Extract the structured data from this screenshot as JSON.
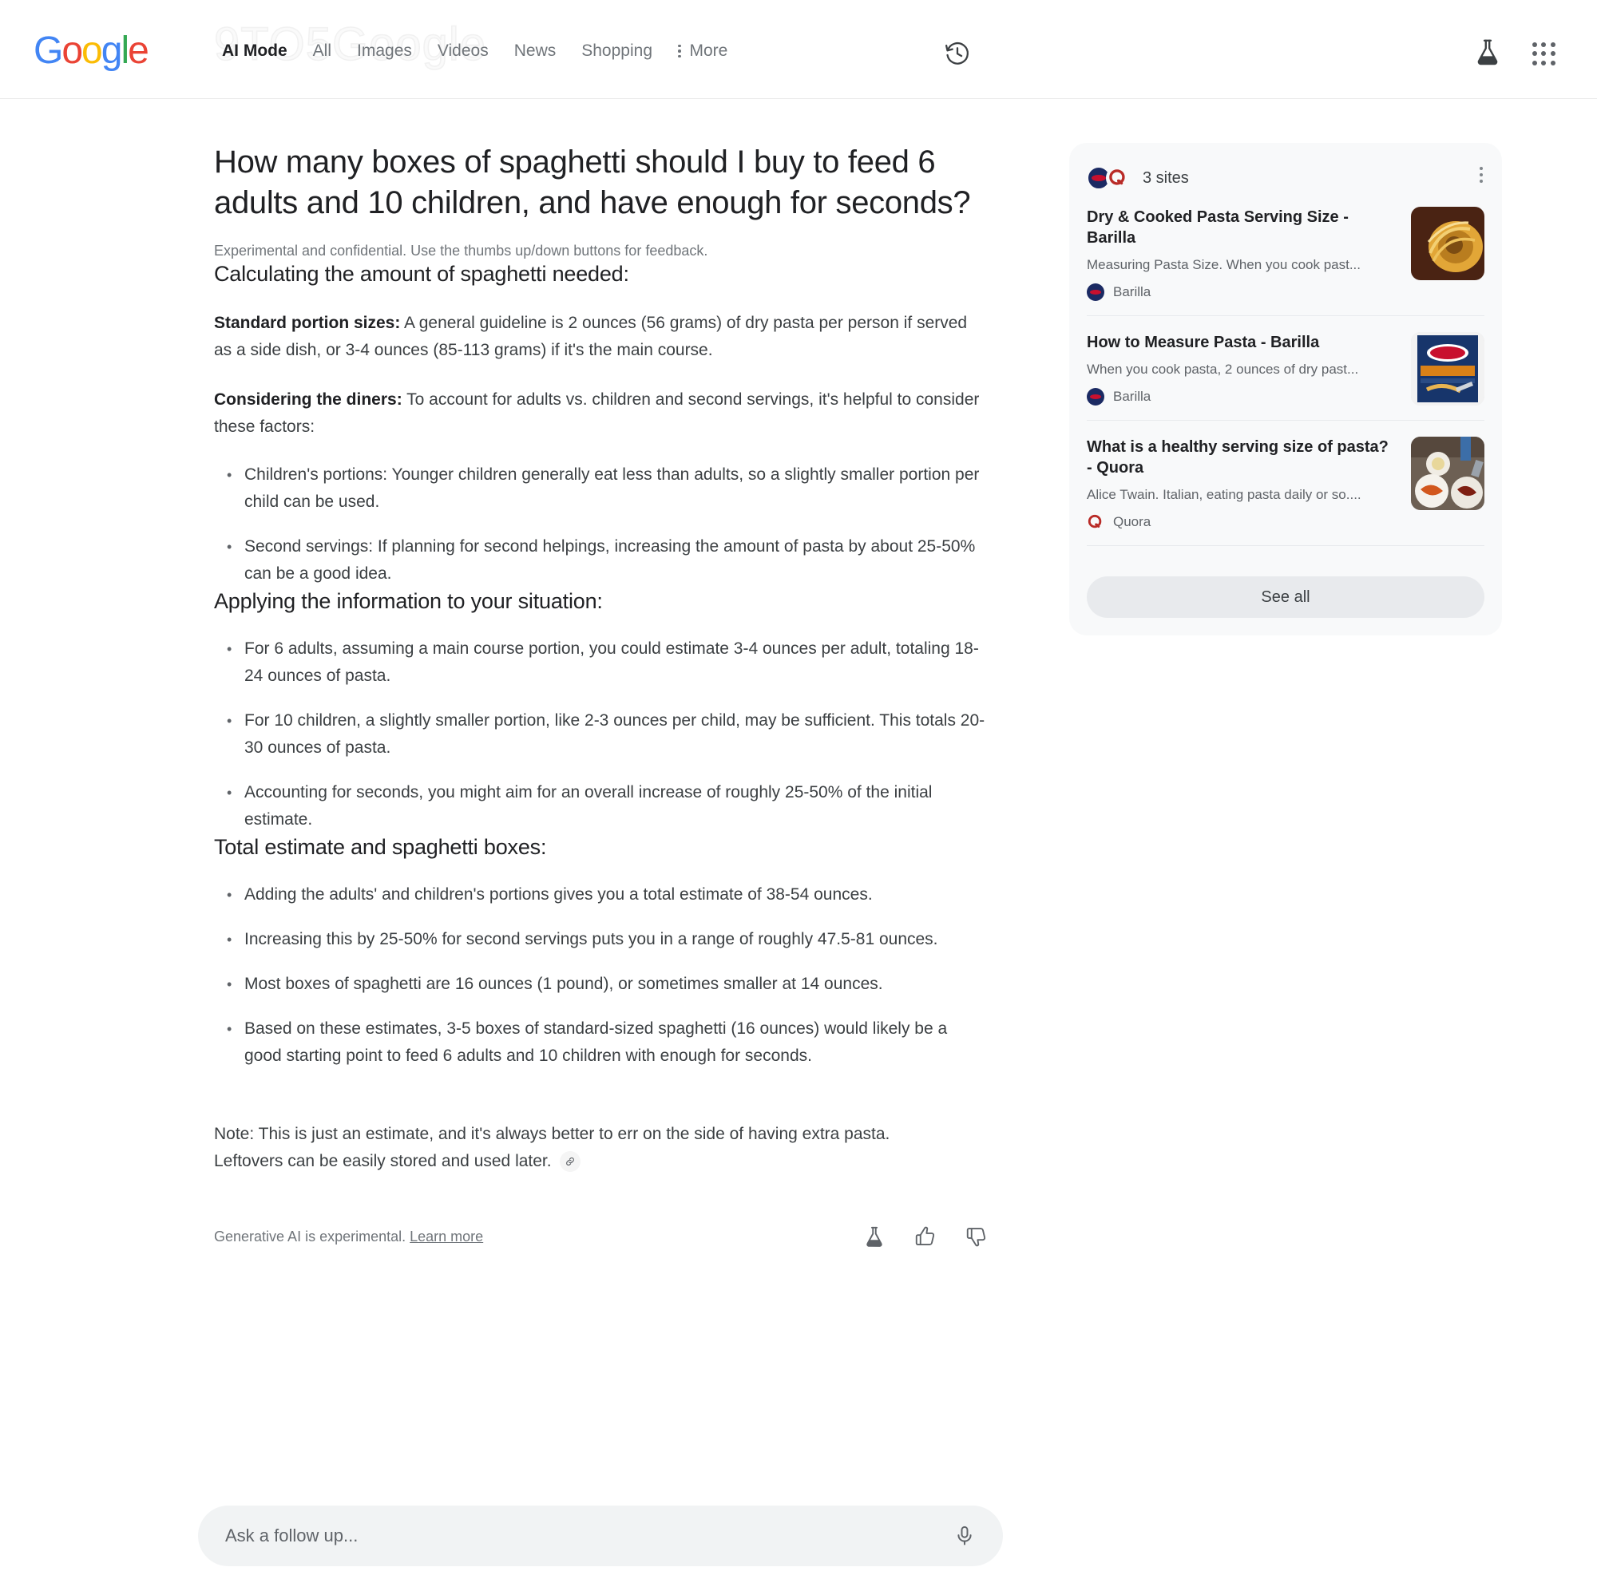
{
  "watermark": "9TO5Google",
  "header": {
    "logo": "Google",
    "tabs": [
      {
        "label": "AI Mode",
        "active": true
      },
      {
        "label": "All",
        "active": false
      },
      {
        "label": "Images",
        "active": false
      },
      {
        "label": "Videos",
        "active": false
      },
      {
        "label": "News",
        "active": false
      },
      {
        "label": "Shopping",
        "active": false
      }
    ],
    "more_label": "More",
    "icons": {
      "history": "history-icon",
      "labs": "flask-icon",
      "apps": "apps-grid-icon"
    }
  },
  "main": {
    "title": "How many boxes of spaghetti should I buy to feed 6 adults and 10 children, and have enough for seconds?",
    "disclaimer": "Experimental and confidential. Use the thumbs up/down buttons for feedback.",
    "sections": [
      {
        "heading": "Calculating the amount of spaghetti needed:",
        "paragraphs": [
          {
            "lead": "Standard portion sizes:",
            "text": " A general guideline is 2 ounces (56 grams) of dry pasta per person if served as a side dish, or 3-4 ounces (85-113 grams) if it's the main course."
          },
          {
            "lead": "Considering the diners:",
            "text": " To account for adults vs. children and second servings, it's helpful to consider these factors:"
          }
        ],
        "bullets": [
          "Children's portions: Younger children generally eat less than adults, so a slightly smaller portion per child can be used.",
          "Second servings: If planning for second helpings, increasing the amount of pasta by about 25-50% can be a good idea."
        ]
      },
      {
        "heading": "Applying the information to your situation:",
        "paragraphs": [],
        "bullets": [
          "For 6 adults, assuming a main course portion, you could estimate 3-4 ounces per adult, totaling 18-24 ounces of pasta.",
          "For 10 children, a slightly smaller portion, like 2-3 ounces per child, may be sufficient. This totals 20-30 ounces of pasta.",
          "Accounting for seconds, you might aim for an overall increase of roughly 25-50% of the initial estimate."
        ]
      },
      {
        "heading": "Total estimate and spaghetti boxes:",
        "paragraphs": [],
        "bullets": [
          "Adding the adults' and children's portions gives you a total estimate of 38-54 ounces.",
          "Increasing this by 25-50% for second servings puts you in a range of roughly 47.5-81 ounces.",
          "Most boxes of spaghetti are 16 ounces (1 pound), or sometimes smaller at 14 ounces.",
          "Based on these estimates, 3-5 boxes of standard-sized spaghetti (16 ounces) would likely be a good starting point to feed 6 adults and 10 children with enough for seconds."
        ]
      }
    ],
    "note": "Note: This is just an estimate, and it's always better to err on the side of having extra pasta. Leftovers can be easily stored and used later.",
    "note_cite_icon": "link-icon"
  },
  "footer": {
    "text": "Generative AI is experimental.",
    "learn_more": "Learn more",
    "icons": {
      "labs": "flask-icon",
      "thumbs_up": "thumb-up-icon",
      "thumbs_down": "thumb-down-icon"
    }
  },
  "followup": {
    "placeholder": "Ask a follow up...",
    "mic_icon": "microphone-icon"
  },
  "sources": {
    "count_label": "3 sites",
    "kebab_icon": "more-options-icon",
    "see_all_label": "See all",
    "items": [
      {
        "title": "Dry & Cooked Pasta Serving Size - Barilla",
        "snippet": "Measuring Pasta Size. When you cook past...",
        "publisher": "Barilla",
        "favicon": "barilla-favicon",
        "thumb": "spaghetti-nest-photo"
      },
      {
        "title": "How to Measure Pasta - Barilla",
        "snippet": "When you cook pasta, 2 ounces of dry past...",
        "publisher": "Barilla",
        "favicon": "barilla-favicon",
        "thumb": "barilla-box-photo"
      },
      {
        "title": "What is a healthy serving size of pasta? - Quora",
        "snippet": "Alice Twain. Italian, eating pasta daily or so....",
        "publisher": "Quora",
        "favicon": "quora-favicon",
        "thumb": "pasta-plates-photo"
      }
    ]
  },
  "colors": {
    "google_blue": "#4285F4",
    "google_red": "#EA4335",
    "google_yellow": "#FBBC05",
    "google_green": "#34A853",
    "quora_red": "#B92B27",
    "barilla_navy": "#1b2a63",
    "card_bg": "#f8f9fa",
    "chip_bg": "#e8eaed"
  }
}
